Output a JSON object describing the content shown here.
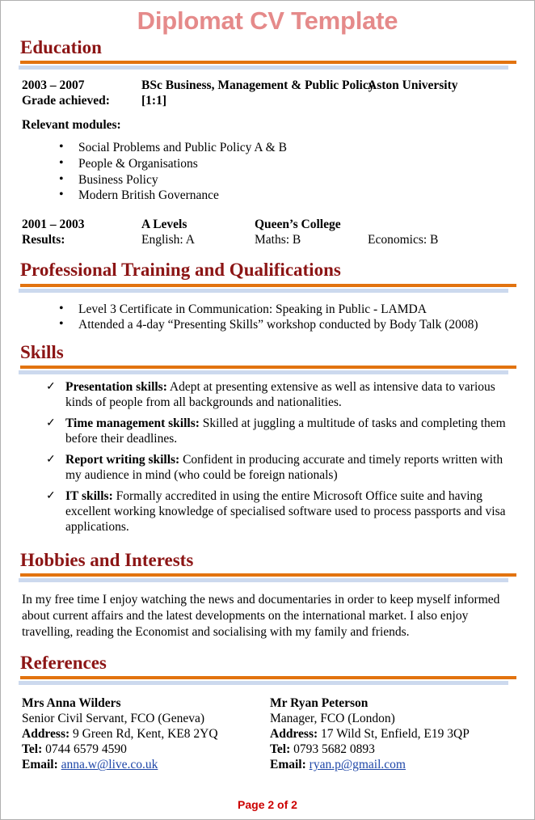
{
  "document": {
    "title": "Diplomat CV Template",
    "footer": "Page 2 of 2"
  },
  "colors": {
    "title": "#e58a8a",
    "section_heading": "#8c1515",
    "rule_orange": "#e2730f",
    "rule_blue": "#ccd9ee",
    "link": "#1f47a8",
    "footer": "#cc0000"
  },
  "sections": {
    "education": {
      "heading": "Education",
      "degree": {
        "dates": "2003 – 2007",
        "title": "BSc Business, Management & Public Policy",
        "institution": "Aston University",
        "grade_label": "Grade achieved:",
        "grade_value": "[1:1]"
      },
      "modules_label": "Relevant modules:",
      "modules": [
        "Social Problems and Public Policy A & B",
        "People & Organisations",
        "Business Policy",
        "Modern British Governance"
      ],
      "alevels": {
        "dates": "2001 – 2003",
        "title": "A Levels",
        "institution": "Queen’s College",
        "results_label": "Results:",
        "results": [
          "English: A",
          "Maths: B",
          "Economics: B"
        ]
      }
    },
    "training": {
      "heading": "Professional Training and Qualifications",
      "items": [
        "Level 3 Certificate in Communication: Speaking in Public - LAMDA",
        "Attended a 4-day “Presenting Skills” workshop conducted by Body Talk (2008)"
      ]
    },
    "skills": {
      "heading": "Skills",
      "items": [
        {
          "label": "Presentation skills:",
          "text": " Adept at presenting extensive as well as intensive data to various kinds of people from all backgrounds and nationalities."
        },
        {
          "label": "Time management skills:",
          "text": " Skilled at juggling a multitude of tasks and completing them before their deadlines."
        },
        {
          "label": "Report writing skills:",
          "text": " Confident in producing accurate and timely reports written with my audience in mind (who could be foreign nationals)"
        },
        {
          "label": "IT skills:",
          "text": " Formally accredited in using the entire Microsoft Office suite and having excellent working knowledge of specialised software used to process passports and visa applications."
        }
      ]
    },
    "hobbies": {
      "heading": "Hobbies and Interests",
      "text": "In my free time I enjoy watching the news and documentaries in order to keep myself informed about current affairs and the latest developments on the international market. I also enjoy travelling, reading the Economist and socialising with my family and friends."
    },
    "references": {
      "heading": "References",
      "address_label": "Address:",
      "tel_label": "Tel:",
      "email_label": "Email:",
      "entries": [
        {
          "name": "Mrs Anna Wilders",
          "role": "Senior Civil Servant, FCO (Geneva)",
          "address": "9 Green Rd, Kent, KE8 2YQ",
          "tel": "0744 6579 4590",
          "email": "anna.w@live.co.uk"
        },
        {
          "name": "Mr Ryan Peterson",
          "role": "Manager, FCO (London)",
          "address": "17 Wild St, Enfield, E19 3QP",
          "tel": "0793 5682 0893",
          "email": "ryan.p@gmail.com"
        }
      ]
    }
  }
}
